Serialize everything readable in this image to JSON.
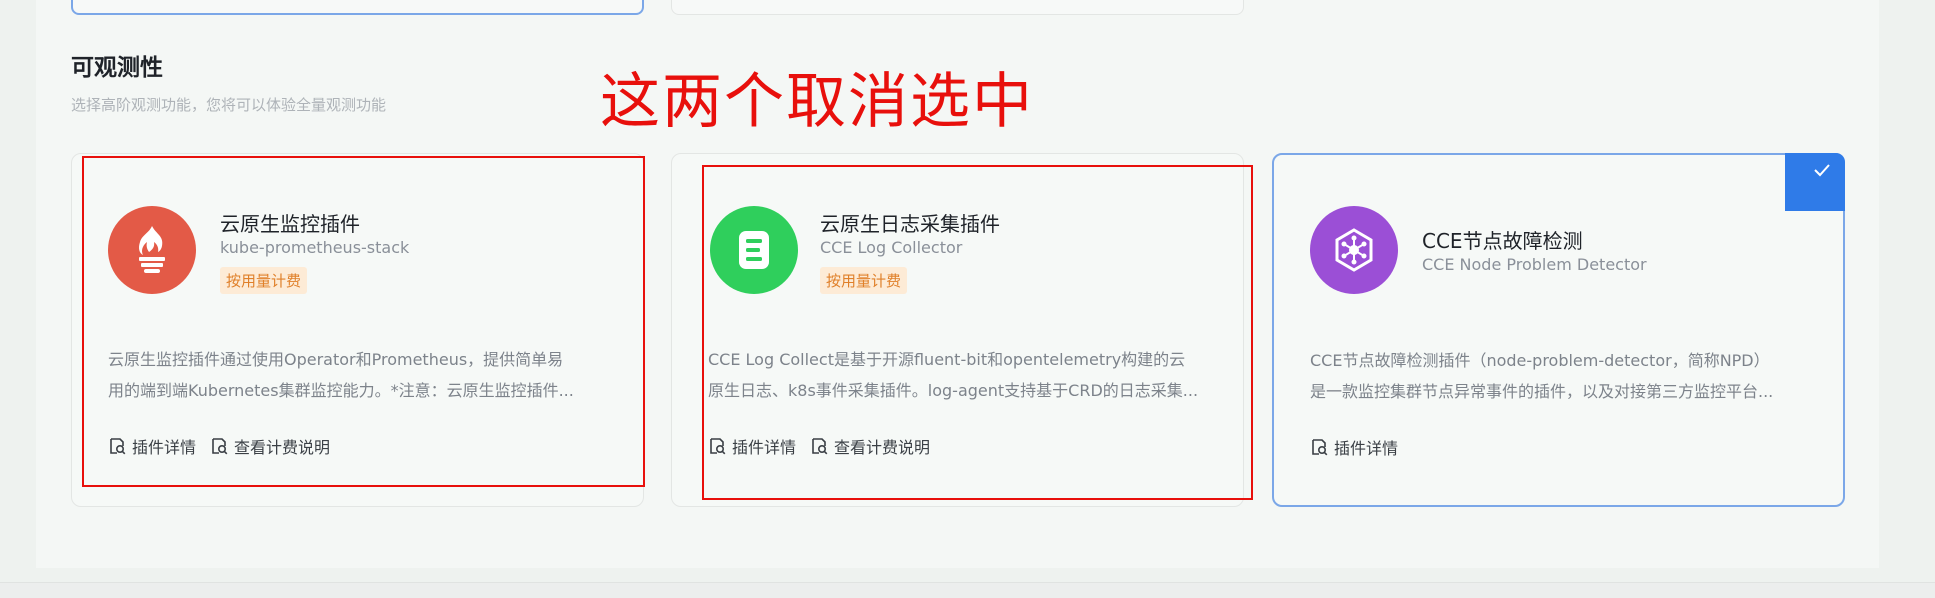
{
  "section": {
    "title": "可观测性",
    "description": "选择高阶观测功能，您将可以体验全量观测功能"
  },
  "annotation": {
    "text": "这两个取消选中",
    "color": "#e8100c"
  },
  "cards": [
    {
      "name": "云原生监控插件",
      "subtitle": "kube-prometheus-stack",
      "badge": "按用量计费",
      "desc_line1": "云原生监控插件通过使用Operator和Prometheus，提供简单易",
      "desc_line2": "用的端到端Kubernetes集群监控能力。*注意：云原生监控插件...",
      "link_details": "插件详情",
      "link_billing": "查看计费说明",
      "icon": "prometheus-flame-icon",
      "logo_color": "#e35a47",
      "selected": false
    },
    {
      "name": "云原生日志采集插件",
      "subtitle": "CCE Log Collector",
      "badge": "按用量计费",
      "desc_line1": "CCE Log Collect是基于开源fluent-bit和opentelemetry构建的云",
      "desc_line2": "原生日志、k8s事件采集插件。log-agent支持基于CRD的日志采集...",
      "link_details": "插件详情",
      "link_billing": "查看计费说明",
      "icon": "log-document-icon",
      "logo_color": "#2fcf5c",
      "selected": false
    },
    {
      "name": "CCE节点故障检测",
      "subtitle": "CCE Node Problem Detector",
      "desc_line1": "CCE节点故障检测插件（node-problem-detector，简称NPD）",
      "desc_line2": "是一款监控集群节点异常事件的插件，以及对接第三方监控平台...",
      "link_details": "插件详情",
      "icon": "hexagon-network-icon",
      "logo_color": "#9b4fd6",
      "selected": true
    }
  ],
  "colors": {
    "selected_border": "#7ba7e8",
    "check_corner": "#2f7be8",
    "badge_bg": "#fdebd6",
    "badge_text": "#e0802a"
  }
}
